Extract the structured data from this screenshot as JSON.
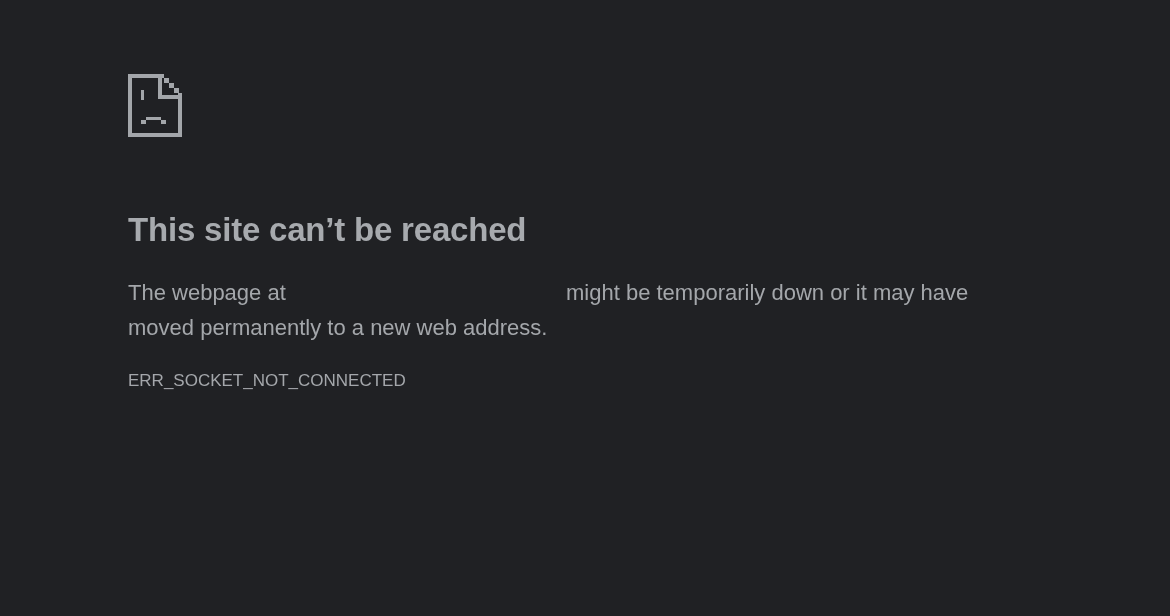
{
  "error_page": {
    "title": "This site can’t be reached",
    "message": {
      "before_address": "The webpage at",
      "after_address": "might be temporarily down or it may have moved permanently to a new web address."
    },
    "error_code": "ERR_SOCKET_NOT_CONNECTED"
  }
}
